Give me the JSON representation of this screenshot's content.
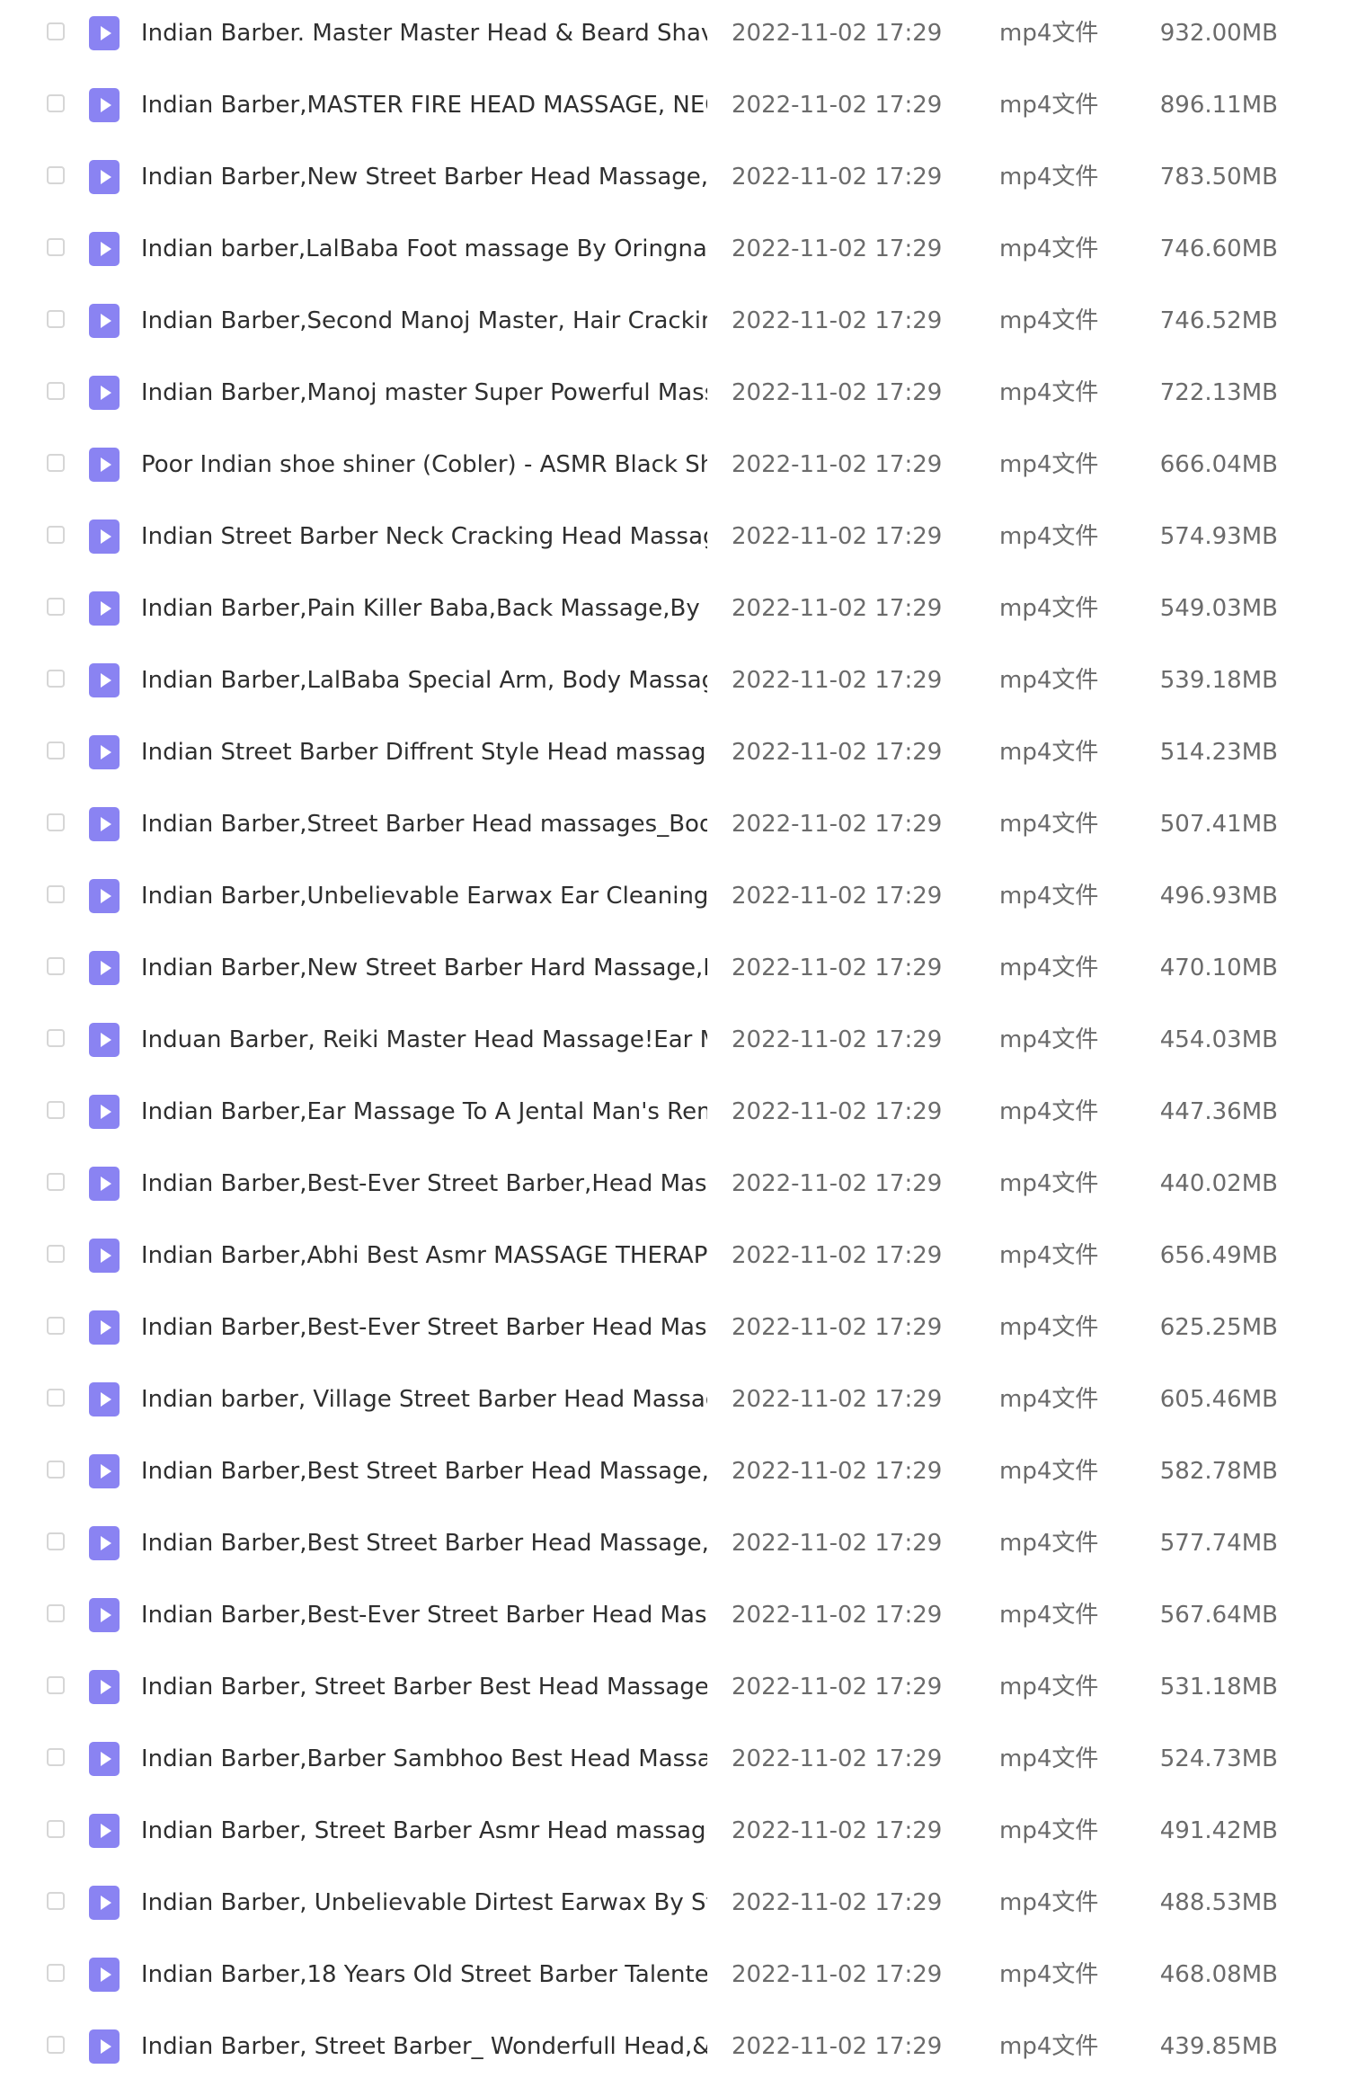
{
  "file_list": {
    "rows": [
      {
        "name": "Indian Barber. Master Master Head & Beard Shave...",
        "date": "2022-11-02 17:29",
        "type": "mp4文件",
        "size": "932.00MB",
        "icon": "video-file-icon"
      },
      {
        "name": "Indian Barber,MASTER FIRE HEAD MASSAGE, NECK ...",
        "date": "2022-11-02 17:29",
        "type": "mp4文件",
        "size": "896.11MB",
        "icon": "video-file-icon"
      },
      {
        "name": "Indian Barber,New Street Barber Head Massage,B...",
        "date": "2022-11-02 17:29",
        "type": "mp4文件",
        "size": "783.50MB",
        "icon": "video-file-icon"
      },
      {
        "name": "Indian barber,LalBaba Foot massage By Oringnal B...",
        "date": "2022-11-02 17:29",
        "type": "mp4文件",
        "size": "746.60MB",
        "icon": "video-file-icon"
      },
      {
        "name": "Indian Barber,Second Manoj Master, Hair Cracking,...",
        "date": "2022-11-02 17:29",
        "type": "mp4文件",
        "size": "746.52MB",
        "icon": "video-file-icon"
      },
      {
        "name": "Indian Barber,Manoj master Super Powerful Massa...",
        "date": "2022-11-02 17:29",
        "type": "mp4文件",
        "size": "722.13MB",
        "icon": "video-file-icon"
      },
      {
        "name": "Poor Indian shoe shiner (Cobler) - ASMR Black Sho...",
        "date": "2022-11-02 17:29",
        "type": "mp4文件",
        "size": "666.04MB",
        "icon": "video-file-icon"
      },
      {
        "name": "Indian Street Barber Neck Cracking Head Massage...",
        "date": "2022-11-02 17:29",
        "type": "mp4文件",
        "size": "574.93MB",
        "icon": "video-file-icon"
      },
      {
        "name": "Indian Barber,Pain Killer Baba,Back Massage,By SM...",
        "date": "2022-11-02 17:29",
        "type": "mp4文件",
        "size": "549.03MB",
        "icon": "video-file-icon"
      },
      {
        "name": "Indian Barber,LalBaba Special Arm, Body Massages...",
        "date": "2022-11-02 17:29",
        "type": "mp4文件",
        "size": "539.18MB",
        "icon": "video-file-icon"
      },
      {
        "name": "Indian Street Barber Diffrent Style Head massage A...",
        "date": "2022-11-02 17:29",
        "type": "mp4文件",
        "size": "514.23MB",
        "icon": "video-file-icon"
      },
      {
        "name": "Indian Barber,Street Barber Head massages_Body ...",
        "date": "2022-11-02 17:29",
        "type": "mp4文件",
        "size": "507.41MB",
        "icon": "video-file-icon"
      },
      {
        "name": "Indian Barber,Unbelievable Earwax Ear Cleaning By ...",
        "date": "2022-11-02 17:29",
        "type": "mp4文件",
        "size": "496.93MB",
        "icon": "video-file-icon"
      },
      {
        "name": "Indian Barber,New Street Barber Hard Massage,Ea...",
        "date": "2022-11-02 17:29",
        "type": "mp4文件",
        "size": "470.10MB",
        "icon": "video-file-icon"
      },
      {
        "name": "Induan Barber, Reiki Master Head Massage!Ear Ma...",
        "date": "2022-11-02 17:29",
        "type": "mp4文件",
        "size": "454.03MB",
        "icon": "video-file-icon"
      },
      {
        "name": "Indian Barber,Ear Massage To A Jental Man's Rem...",
        "date": "2022-11-02 17:29",
        "type": "mp4文件",
        "size": "447.36MB",
        "icon": "video-file-icon"
      },
      {
        "name": "Indian Barber,Best-Ever Street Barber,Head Massa...",
        "date": "2022-11-02 17:29",
        "type": "mp4文件",
        "size": "440.02MB",
        "icon": "video-file-icon"
      },
      {
        "name": "Indian Barber,Abhi Best Asmr MASSAGE THERAPY,B...",
        "date": "2022-11-02 17:29",
        "type": "mp4文件",
        "size": "656.49MB",
        "icon": "video-file-icon"
      },
      {
        "name": "Indian Barber,Best-Ever Street Barber Head Massa...",
        "date": "2022-11-02 17:29",
        "type": "mp4文件",
        "size": "625.25MB",
        "icon": "video-file-icon"
      },
      {
        "name": "Indian barber, Village Street Barber Head Massage...",
        "date": "2022-11-02 17:29",
        "type": "mp4文件",
        "size": "605.46MB",
        "icon": "video-file-icon"
      },
      {
        "name": "Indian Barber,Best Street Barber Head Massage,Bo...",
        "date": "2022-11-02 17:29",
        "type": "mp4文件",
        "size": "582.78MB",
        "icon": "video-file-icon"
      },
      {
        "name": "Indian Barber,Best Street Barber Head Massage,Bo...",
        "date": "2022-11-02 17:29",
        "type": "mp4文件",
        "size": "577.74MB",
        "icon": "video-file-icon"
      },
      {
        "name": "Indian Barber,Best-Ever Street Barber Head Massa...",
        "date": "2022-11-02 17:29",
        "type": "mp4文件",
        "size": "567.64MB",
        "icon": "video-file-icon"
      },
      {
        "name": "Indian Barber, Street Barber Best Head Massage B...",
        "date": "2022-11-02 17:29",
        "type": "mp4文件",
        "size": "531.18MB",
        "icon": "video-file-icon"
      },
      {
        "name": "Indian Barber,Barber Sambhoo Best Head Massag...",
        "date": "2022-11-02 17:29",
        "type": "mp4文件",
        "size": "524.73MB",
        "icon": "video-file-icon"
      },
      {
        "name": "Indian Barber, Street Barber Asmr Head massages ...",
        "date": "2022-11-02 17:29",
        "type": "mp4文件",
        "size": "491.42MB",
        "icon": "video-file-icon"
      },
      {
        "name": "Indian Barber, Unbelievable Dirtest Earwax By  Stre...",
        "date": "2022-11-02 17:29",
        "type": "mp4文件",
        "size": "488.53MB",
        "icon": "video-file-icon"
      },
      {
        "name": "Indian Barber,18 Years Old Street Barber Talented ...",
        "date": "2022-11-02 17:29",
        "type": "mp4文件",
        "size": "468.08MB",
        "icon": "video-file-icon"
      },
      {
        "name": "Indian Barber, Street Barber_ Wonderfull Head,& ...",
        "date": "2022-11-02 17:29",
        "type": "mp4文件",
        "size": "439.85MB",
        "icon": "video-file-icon"
      }
    ]
  },
  "colors": {
    "icon": "#8a83f2",
    "text": "#2f2f2f",
    "muted_text": "#6b6b6b",
    "checkbox_border": "#d6d6d6"
  }
}
